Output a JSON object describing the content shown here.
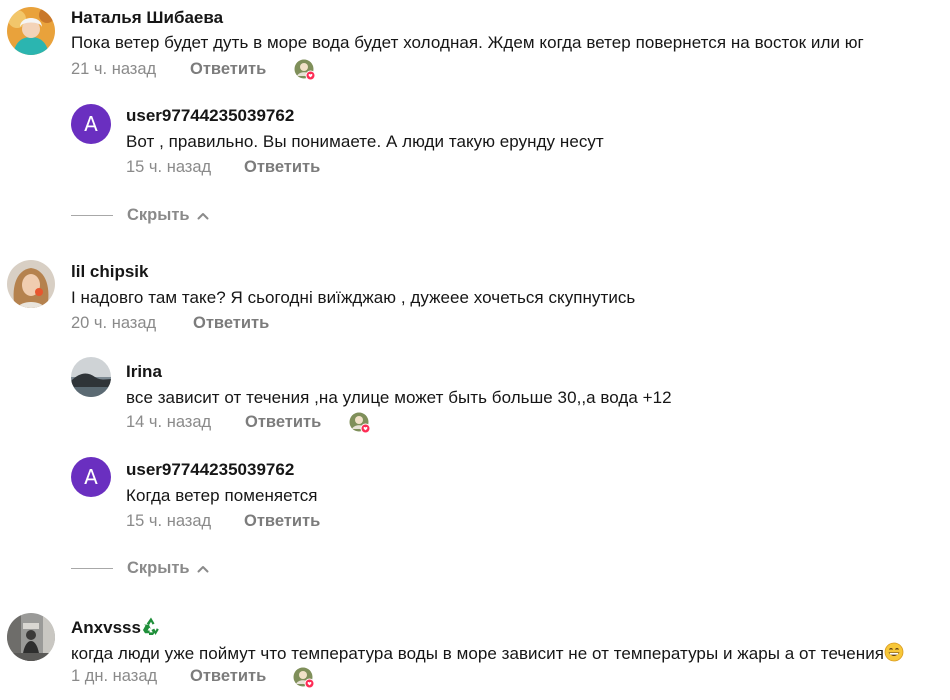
{
  "comments": [
    {
      "author": "Наталья Шибаева",
      "text": "Пока ветер будет дуть в море вода будет холодная. Ждем когда ветер повернется на восток или юг",
      "time": "21 ч. назад",
      "reply_label": "Ответить",
      "liked_by_author": true,
      "replies": [
        {
          "author": "user97744235039762",
          "avatar_letter": "A",
          "text": "Вот , правильно. Вы понимаете. А люди такую ерунду несут",
          "time": "15 ч. назад",
          "reply_label": "Ответить"
        }
      ],
      "hide_label": "Скрыть"
    },
    {
      "author": "lil chipsik",
      "text": "І надовго там таке? Я сьогодні виїжджаю , дужеее хочеться скупнутись",
      "time": "20 ч. назад",
      "reply_label": "Ответить",
      "replies": [
        {
          "author": "Irina",
          "text": "все зависит от течения ,на улице может быть больше 30,,а вода +12",
          "time": "14 ч. назад",
          "reply_label": "Ответить",
          "liked_by_author": true
        },
        {
          "author": "user97744235039762",
          "avatar_letter": "A",
          "text": "Когда ветер поменяется",
          "time": "15 ч. назад",
          "reply_label": "Ответить"
        }
      ],
      "hide_label": "Скрыть"
    },
    {
      "author": "Anxvsss",
      "author_emoji": "recycle-emoji",
      "text": "когда люди уже поймут что температура воды в море зависит не от температуры и жары а от течения",
      "text_emoji": "grinning-face-emoji",
      "time": "1 дн. назад",
      "reply_label": "Ответить",
      "liked_by_author": true
    }
  ],
  "colors": {
    "letter_avatar": "#6a2fc0",
    "like_badge": "#fe2c55",
    "meta_text": "#8a8a8a"
  }
}
